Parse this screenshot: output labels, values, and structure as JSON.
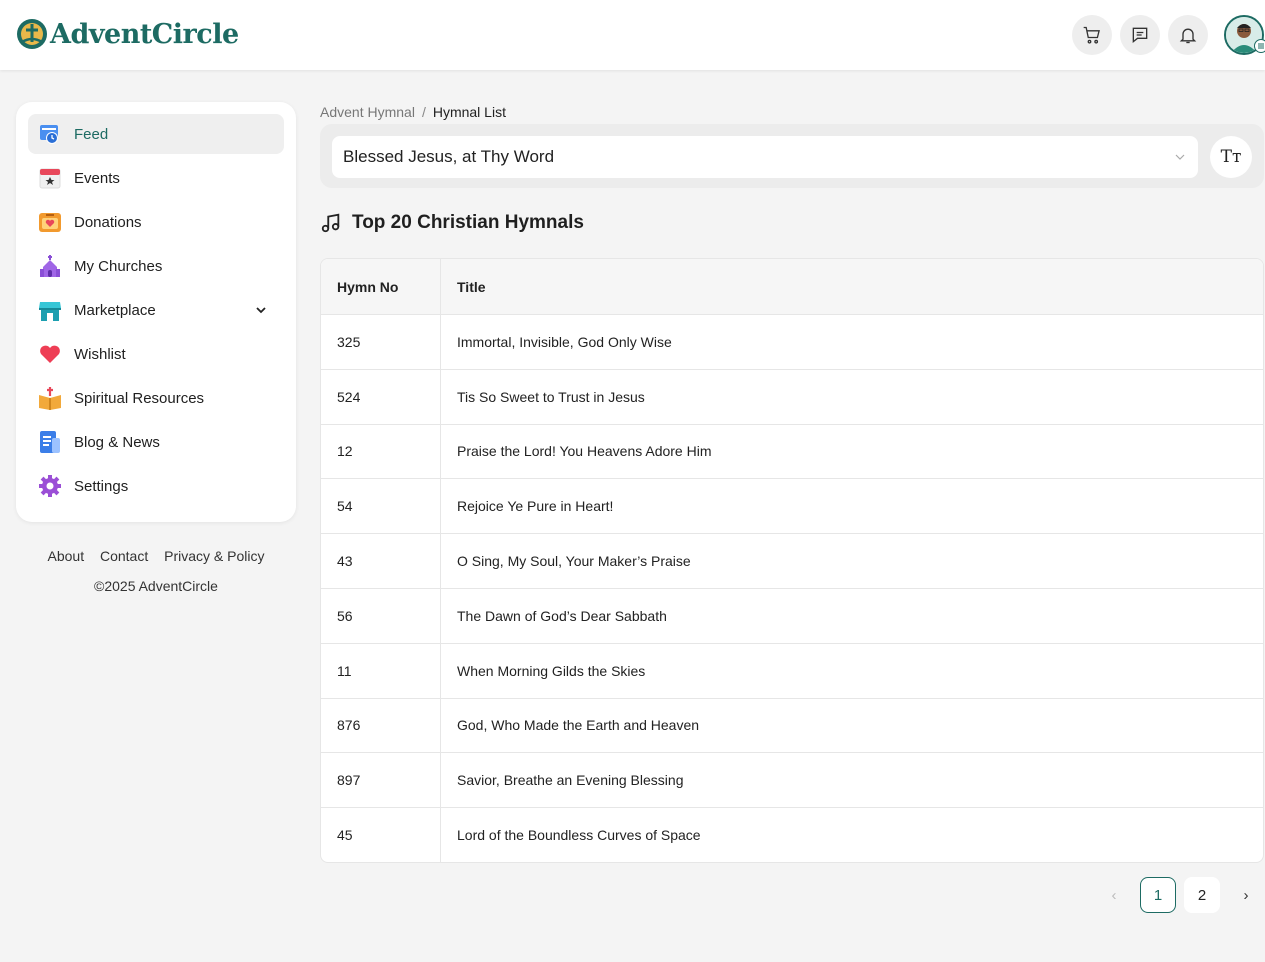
{
  "header": {
    "brand": "AdventCircle",
    "icons": [
      "cart-icon",
      "message-icon",
      "bell-icon",
      "avatar"
    ]
  },
  "sidebar": {
    "items": [
      {
        "label": "Feed",
        "icon": "feed-icon",
        "active": true
      },
      {
        "label": "Events",
        "icon": "calendar-icon"
      },
      {
        "label": "Donations",
        "icon": "donation-box-icon"
      },
      {
        "label": "My Churches",
        "icon": "church-icon"
      },
      {
        "label": "Marketplace",
        "icon": "store-icon",
        "expandable": true
      },
      {
        "label": "Wishlist",
        "icon": "heart-icon"
      },
      {
        "label": "Spiritual Resources",
        "icon": "bible-icon"
      },
      {
        "label": "Blog & News",
        "icon": "document-icon"
      },
      {
        "label": "Settings",
        "icon": "gear-icon"
      }
    ]
  },
  "footer": {
    "about": "About",
    "contact": "Contact",
    "privacy": "Privacy & Policy",
    "copyright": "©2025 AdventCircle"
  },
  "breadcrumb": {
    "parent": "Advent Hymnal",
    "separator": "/",
    "current": "Hymnal List"
  },
  "hymn_select": {
    "value": "Blessed Jesus, at Thy Word",
    "font_button": "Tт"
  },
  "section": {
    "title": "Top 20 Christian Hymnals"
  },
  "table": {
    "headers": {
      "no": "Hymn No",
      "title": "Title"
    },
    "rows": [
      {
        "no": "325",
        "title": "Immortal, Invisible, God Only Wise"
      },
      {
        "no": "524",
        "title": "Tis So Sweet to Trust in Jesus"
      },
      {
        "no": "12",
        "title": "Praise the Lord! You Heavens Adore Him"
      },
      {
        "no": "54",
        "title": "Rejoice Ye Pure in Heart!"
      },
      {
        "no": "43",
        "title": "O Sing, My Soul, Your Maker’s Praise"
      },
      {
        "no": "56",
        "title": "The Dawn of God’s Dear Sabbath"
      },
      {
        "no": "11",
        "title": "When Morning Gilds the Skies"
      },
      {
        "no": "876",
        "title": "God, Who Made the Earth and Heaven"
      },
      {
        "no": "897",
        "title": "Savior, Breathe an Evening Blessing"
      },
      {
        "no": "45",
        "title": "Lord of the Boundless Curves of Space"
      }
    ]
  },
  "pagination": {
    "prev": "‹",
    "pages": [
      "1",
      "2"
    ],
    "current": "1",
    "next": "›"
  },
  "colors": {
    "brand": "#1d6b63",
    "background": "#f4f4f4"
  }
}
